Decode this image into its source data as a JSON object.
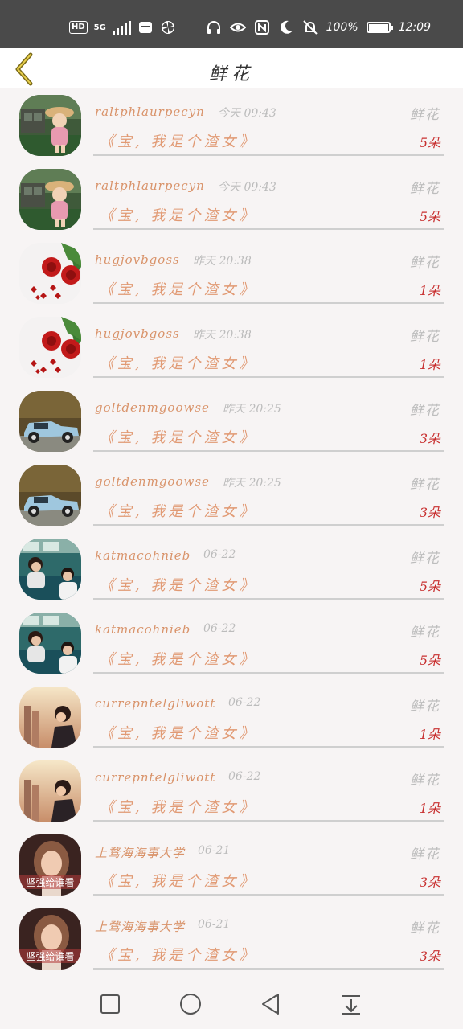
{
  "status": {
    "left_chip": "HD",
    "network": "5G",
    "battery": "100%",
    "battery_level": 1.0,
    "time": "12:09"
  },
  "header": {
    "title": "鲜花"
  },
  "rows": [
    {
      "name": "raltphlaurpecyn",
      "time": "今天 09:43",
      "type": "鲜花",
      "title": "《宝, 我是个渣女》",
      "count": "5朵",
      "avatar": "girl-garden",
      "caption": ""
    },
    {
      "name": "raltphlaurpecyn",
      "time": "今天 09:43",
      "type": "鲜花",
      "title": "《宝, 我是个渣女》",
      "count": "5朵",
      "avatar": "girl-garden",
      "caption": ""
    },
    {
      "name": "hugjovbgoss",
      "time": "昨天 20:38",
      "type": "鲜花",
      "title": "《宝, 我是个渣女》",
      "count": "1朵",
      "avatar": "roses",
      "caption": ""
    },
    {
      "name": "hugjovbgoss",
      "time": "昨天 20:38",
      "type": "鲜花",
      "title": "《宝, 我是个渣女》",
      "count": "1朵",
      "avatar": "roses",
      "caption": ""
    },
    {
      "name": "goltdenmgoowse",
      "time": "昨天 20:25",
      "type": "鲜花",
      "title": "《宝, 我是个渣女》",
      "count": "3朵",
      "avatar": "vintage-car",
      "caption": ""
    },
    {
      "name": "goltdenmgoowse",
      "time": "昨天 20:25",
      "type": "鲜花",
      "title": "《宝, 我是个渣女》",
      "count": "3朵",
      "avatar": "vintage-car",
      "caption": ""
    },
    {
      "name": "katmacohnieb",
      "time": "06-22",
      "type": "鲜花",
      "title": "《宝, 我是个渣女》",
      "count": "5朵",
      "avatar": "train-couple",
      "caption": ""
    },
    {
      "name": "katmacohnieb",
      "time": "06-22",
      "type": "鲜花",
      "title": "《宝, 我是个渣女》",
      "count": "5朵",
      "avatar": "train-couple",
      "caption": ""
    },
    {
      "name": "currepntelgliwott",
      "time": "06-22",
      "type": "鲜花",
      "title": "《宝, 我是个渣女》",
      "count": "1朵",
      "avatar": "sunset-girl",
      "caption": ""
    },
    {
      "name": "currepntelgliwott",
      "time": "06-22",
      "type": "鲜花",
      "title": "《宝, 我是个渣女》",
      "count": "1朵",
      "avatar": "sunset-girl",
      "caption": ""
    },
    {
      "name": "上骛海海事大学",
      "time": "06-21",
      "type": "鲜花",
      "title": "《宝, 我是个渣女》",
      "count": "3朵",
      "avatar": "portrait-girl",
      "caption": "坚强给谁看"
    },
    {
      "name": "上骛海海事大学",
      "time": "06-21",
      "type": "鲜花",
      "title": "《宝, 我是个渣女》",
      "count": "3朵",
      "avatar": "portrait-girl",
      "caption": "坚强给谁看"
    }
  ],
  "nav": [
    "recent-apps-icon",
    "home-icon",
    "back-icon",
    "notification-shade-icon"
  ]
}
